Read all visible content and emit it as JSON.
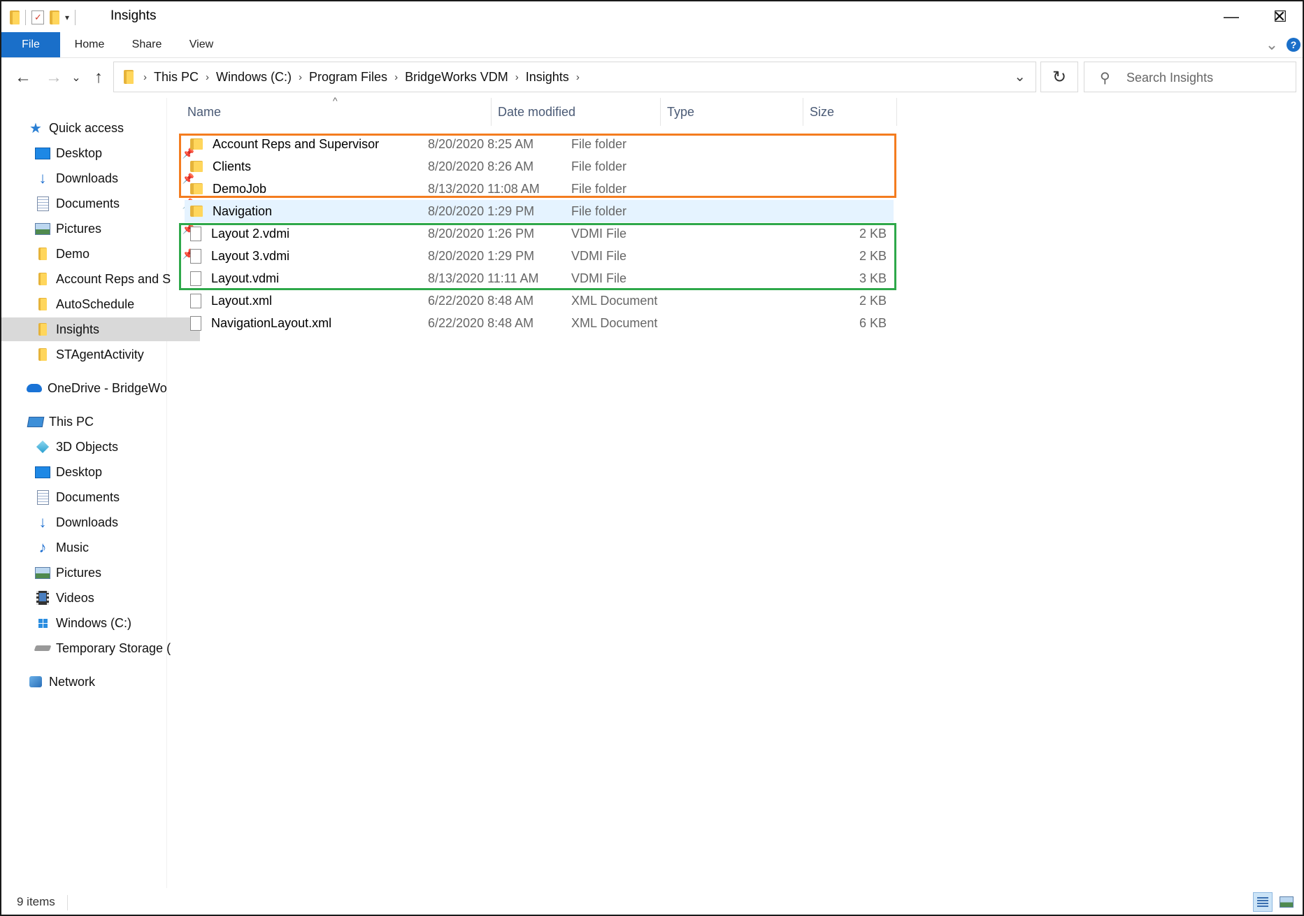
{
  "window": {
    "title": "Insights"
  },
  "controls": {
    "minimize": "—",
    "maximize": "☐",
    "close": "✕"
  },
  "ribbon": {
    "tabs": [
      "File",
      "Home",
      "Share",
      "View"
    ],
    "expand": "⌄",
    "help": "?"
  },
  "nav_buttons": {
    "back": "←",
    "forward": "→",
    "recent": "⌄",
    "up": "↑"
  },
  "address": {
    "crumbs": [
      "This PC",
      "Windows (C:)",
      "Program Files",
      "BridgeWorks VDM",
      "Insights"
    ],
    "separator": "›",
    "dropdown": "⌄",
    "refresh": "↻"
  },
  "search": {
    "placeholder": "Search Insights",
    "icon_glyph": "⚲"
  },
  "sidebar": {
    "quick_access": "Quick access",
    "pinned": [
      {
        "label": "Desktop",
        "icon": "desktop-icon"
      },
      {
        "label": "Downloads",
        "icon": "downloads-icon"
      },
      {
        "label": "Documents",
        "icon": "documents-icon"
      },
      {
        "label": "Pictures",
        "icon": "pictures-icon"
      },
      {
        "label": "Demo",
        "icon": "folder-icon"
      }
    ],
    "recent": [
      "Account Reps and S",
      "AutoSchedule",
      "Insights",
      "STAgentActivity"
    ],
    "selected": "Insights",
    "onedrive": "OneDrive - BridgeWo",
    "this_pc": "This PC",
    "this_pc_items": [
      {
        "label": "3D Objects",
        "icon": "3d-objects-icon"
      },
      {
        "label": "Desktop",
        "icon": "desktop-icon"
      },
      {
        "label": "Documents",
        "icon": "documents-icon"
      },
      {
        "label": "Downloads",
        "icon": "downloads-icon"
      },
      {
        "label": "Music",
        "icon": "music-icon"
      },
      {
        "label": "Pictures",
        "icon": "pictures-icon"
      },
      {
        "label": "Videos",
        "icon": "videos-icon"
      },
      {
        "label": "Windows (C:)",
        "icon": "drive-icon"
      },
      {
        "label": "Temporary Storage (",
        "icon": "drive-icon"
      }
    ],
    "network": "Network",
    "pin_glyph": "📌"
  },
  "columns": {
    "name": "Name",
    "date": "Date modified",
    "type": "Type",
    "size": "Size",
    "sort_glyph": "^"
  },
  "files": [
    {
      "name": "Account Reps and Supervisor",
      "date": "8/20/2020 8:25 AM",
      "type": "File folder",
      "size": "",
      "kind": "folder"
    },
    {
      "name": "Clients",
      "date": "8/20/2020 8:26 AM",
      "type": "File folder",
      "size": "",
      "kind": "folder"
    },
    {
      "name": "DemoJob",
      "date": "8/13/2020 11:08 AM",
      "type": "File folder",
      "size": "",
      "kind": "folder"
    },
    {
      "name": "Navigation",
      "date": "8/20/2020 1:29 PM",
      "type": "File folder",
      "size": "",
      "kind": "folder"
    },
    {
      "name": "Layout 2.vdmi",
      "date": "8/20/2020 1:26 PM",
      "type": "VDMI File",
      "size": "2 KB",
      "kind": "file"
    },
    {
      "name": "Layout 3.vdmi",
      "date": "8/20/2020 1:29 PM",
      "type": "VDMI File",
      "size": "2 KB",
      "kind": "file"
    },
    {
      "name": "Layout.vdmi",
      "date": "8/13/2020 11:11 AM",
      "type": "VDMI File",
      "size": "3 KB",
      "kind": "file"
    },
    {
      "name": "Layout.xml",
      "date": "6/22/2020 8:48 AM",
      "type": "XML Document",
      "size": "2 KB",
      "kind": "file"
    },
    {
      "name": "NavigationLayout.xml",
      "date": "6/22/2020 8:48 AM",
      "type": "XML Document",
      "size": "6 KB",
      "kind": "file"
    }
  ],
  "highlighted_row": "Navigation",
  "annotations": {
    "orange": "#f47c1f",
    "green": "#2ea84a"
  },
  "status": {
    "items": "9 items"
  },
  "colors": {
    "accent": "#1a6fc9",
    "folder": "#ffd65c",
    "folder_dark": "#e6b33a",
    "selection": "#e5f3ff"
  }
}
